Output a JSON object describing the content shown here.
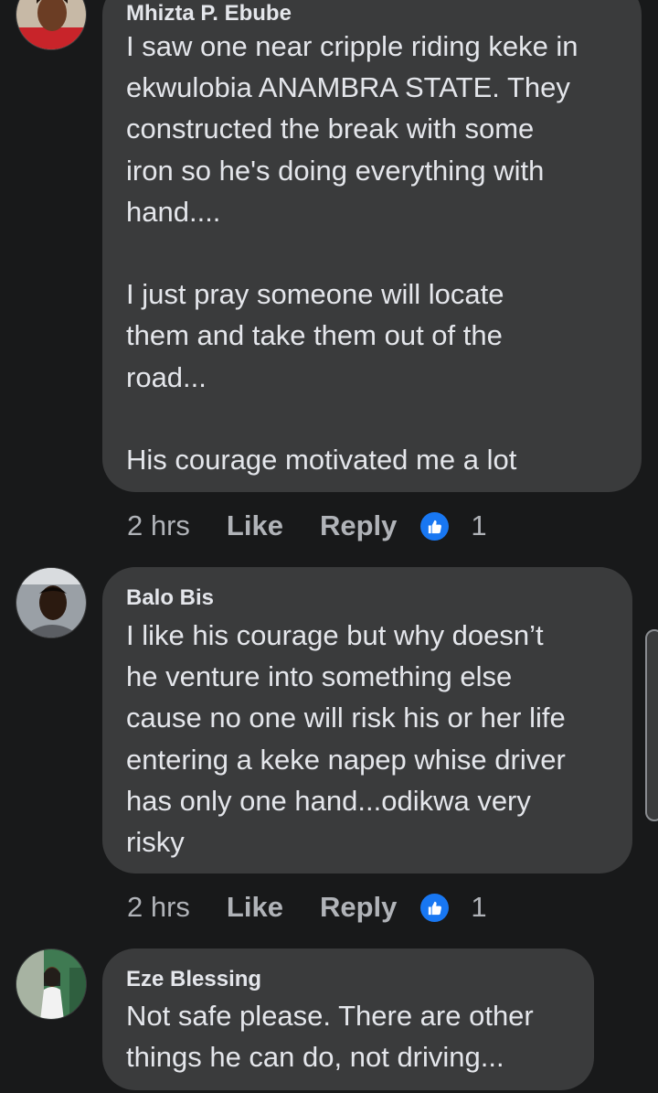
{
  "comments": [
    {
      "author": "Mhizta P. Ebube",
      "lines": [
        "I saw one near cripple riding keke in",
        "ekwulobia ANAMBRA STATE. They",
        "constructed the break with some",
        "iron so he's doing everything with",
        "hand....",
        "",
        "I just pray someone will locate",
        "them and take them out of the",
        "road...",
        "",
        "His courage motivated me a lot"
      ],
      "time": "2 hrs",
      "like_label": "Like",
      "reply_label": "Reply",
      "reaction_count": "1",
      "reaction_icon": "like-reaction-icon"
    },
    {
      "author": "Balo Bis",
      "lines": [
        "I like his courage but why doesn’t",
        "he venture into something else",
        "cause no one will risk his or her life",
        "entering a keke napep whise driver",
        "has only one hand...odikwa very",
        "risky"
      ],
      "time": "2 hrs",
      "like_label": "Like",
      "reply_label": "Reply",
      "reaction_count": "1",
      "reaction_icon": "like-reaction-icon"
    },
    {
      "author": "Eze Blessing",
      "lines": [
        "Not safe please. There are other",
        "things he can do, not driving..."
      ]
    }
  ],
  "colors": {
    "background": "#18191a",
    "bubble": "#3a3b3c",
    "text": "#e4e6eb",
    "secondary_text": "#b0b3b8",
    "reaction_blue": "#1877f2"
  }
}
